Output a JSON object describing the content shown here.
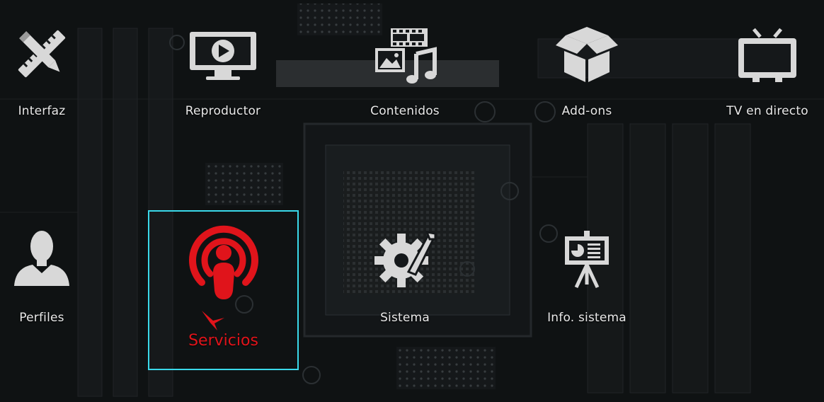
{
  "menu": {
    "row1": [
      {
        "id": "interfaz",
        "label": "Interfaz",
        "icon": "pencil-ruler-icon"
      },
      {
        "id": "reproductor",
        "label": "Reproductor",
        "icon": "monitor-play-icon"
      },
      {
        "id": "contenidos",
        "label": "Contenidos",
        "icon": "media-content-icon"
      },
      {
        "id": "addons",
        "label": "Add-ons",
        "icon": "open-box-icon"
      },
      {
        "id": "tv",
        "label": "TV en directo",
        "icon": "tv-antenna-icon"
      }
    ],
    "row2": [
      {
        "id": "perfiles",
        "label": "Perfiles",
        "icon": "user-profile-icon"
      },
      {
        "id": "servicios",
        "label": "Servicios",
        "icon": "podcast-broadcast-icon",
        "focused": true
      },
      {
        "id": "sistema",
        "label": "Sistema",
        "icon": "gear-tools-icon"
      },
      {
        "id": "infosistema",
        "label": "Info. sistema",
        "icon": "presentation-board-icon"
      }
    ]
  },
  "colors": {
    "icon": "#d8d8d8",
    "focus_frame": "#3ad9ea",
    "accent": "#e0141b",
    "background": "#15181a"
  }
}
